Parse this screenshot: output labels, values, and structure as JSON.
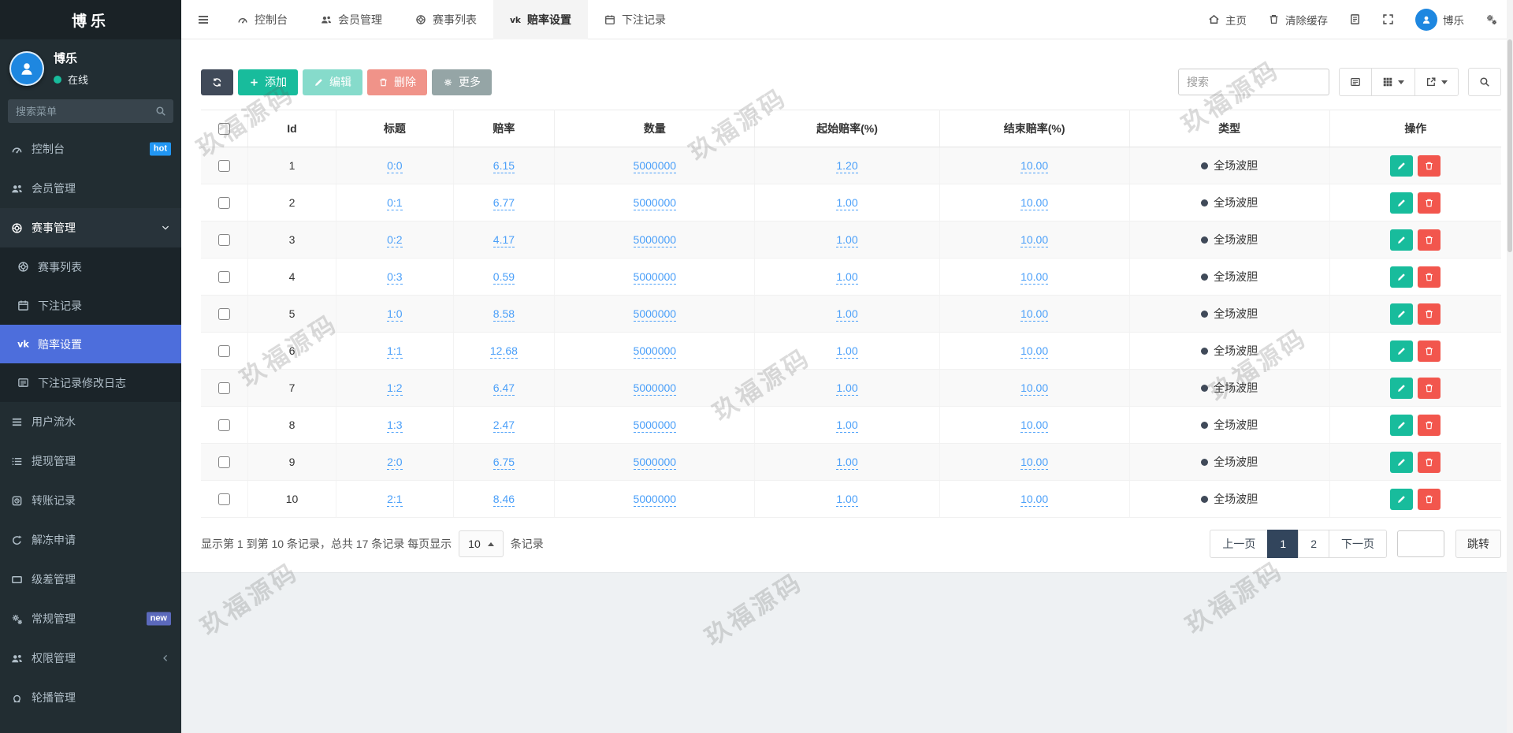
{
  "app": {
    "logo_text": "博乐",
    "watermark_text": "玖福源码"
  },
  "colors": {
    "sidebar_active": "#4d6edc",
    "btn_dark": "#404a59",
    "btn_green": "#18bc9c",
    "btn_red": "#e74c3c",
    "btn_gray": "#95a5a6",
    "op_red": "#f2564d",
    "link_blue": "#4a9ff9",
    "hot_badge": "#2196f3",
    "new_badge": "#5b69bc",
    "avatar_blue": "#1e87e0",
    "online_green": "#18bc9c",
    "page_active": "#32455c",
    "type_dot": "#404a59"
  },
  "topnav": {
    "tabs": [
      {
        "label": "控制台",
        "icon": "gauge",
        "active": false
      },
      {
        "label": "会员管理",
        "icon": "users",
        "active": false
      },
      {
        "label": "赛事列表",
        "icon": "soccer",
        "active": false
      },
      {
        "label": "赔率设置",
        "icon": "vk",
        "active": true
      },
      {
        "label": "下注记录",
        "icon": "calendar",
        "active": false
      }
    ],
    "right_items": [
      {
        "label": "主页",
        "icon": "home",
        "name": "home"
      },
      {
        "label": "清除缓存",
        "icon": "trash",
        "name": "clear-cache"
      },
      {
        "label": "",
        "icon": "file",
        "name": "document"
      },
      {
        "label": "",
        "icon": "expand",
        "name": "fullscreen"
      },
      {
        "label": "博乐",
        "icon": "person",
        "name": "user-menu"
      },
      {
        "label": "",
        "icon": "cogs",
        "name": "settings"
      }
    ]
  },
  "sidebar": {
    "user": {
      "name": "博乐",
      "status": "在线"
    },
    "search_placeholder": "搜索菜单",
    "menu": [
      {
        "label": "控制台",
        "icon": "gauge",
        "badge": "hot"
      },
      {
        "label": "会员管理",
        "icon": "users"
      },
      {
        "label": "赛事管理",
        "icon": "soccer",
        "expanded": true,
        "children": [
          {
            "label": "赛事列表",
            "icon": "soccer"
          },
          {
            "label": "下注记录",
            "icon": "calendar"
          },
          {
            "label": "赔率设置",
            "icon": "vk",
            "active": true
          },
          {
            "label": "下注记录修改日志",
            "icon": "listalt"
          }
        ]
      },
      {
        "label": "用户流水",
        "icon": "bars"
      },
      {
        "label": "提现管理",
        "icon": "tasks"
      },
      {
        "label": "转账记录",
        "icon": "transfer"
      },
      {
        "label": "解冻申请",
        "icon": "redo"
      },
      {
        "label": "级差管理",
        "icon": "rect"
      },
      {
        "label": "常规管理",
        "icon": "cogs",
        "badge": "new"
      },
      {
        "label": "权限管理",
        "icon": "users",
        "collapsed": true
      },
      {
        "label": "轮播管理",
        "icon": "image"
      }
    ]
  },
  "toolbar": {
    "add_label": "添加",
    "edit_label": "编辑",
    "delete_label": "删除",
    "more_label": "更多",
    "search_placeholder": "搜索"
  },
  "table": {
    "columns": [
      "Id",
      "标题",
      "赔率",
      "数量",
      "起始赔率(%)",
      "结束赔率(%)",
      "类型",
      "操作"
    ],
    "rows": [
      {
        "id": "1",
        "title": "0:0",
        "odds": "6.15",
        "quantity": "5000000",
        "start_rate": "1.20",
        "end_rate": "10.00",
        "type": "全场波胆"
      },
      {
        "id": "2",
        "title": "0:1",
        "odds": "6.77",
        "quantity": "5000000",
        "start_rate": "1.00",
        "end_rate": "10.00",
        "type": "全场波胆"
      },
      {
        "id": "3",
        "title": "0:2",
        "odds": "4.17",
        "quantity": "5000000",
        "start_rate": "1.00",
        "end_rate": "10.00",
        "type": "全场波胆"
      },
      {
        "id": "4",
        "title": "0:3",
        "odds": "0.59",
        "quantity": "5000000",
        "start_rate": "1.00",
        "end_rate": "10.00",
        "type": "全场波胆"
      },
      {
        "id": "5",
        "title": "1:0",
        "odds": "8.58",
        "quantity": "5000000",
        "start_rate": "1.00",
        "end_rate": "10.00",
        "type": "全场波胆"
      },
      {
        "id": "6",
        "title": "1:1",
        "odds": "12.68",
        "quantity": "5000000",
        "start_rate": "1.00",
        "end_rate": "10.00",
        "type": "全场波胆"
      },
      {
        "id": "7",
        "title": "1:2",
        "odds": "6.47",
        "quantity": "5000000",
        "start_rate": "1.00",
        "end_rate": "10.00",
        "type": "全场波胆"
      },
      {
        "id": "8",
        "title": "1:3",
        "odds": "2.47",
        "quantity": "5000000",
        "start_rate": "1.00",
        "end_rate": "10.00",
        "type": "全场波胆"
      },
      {
        "id": "9",
        "title": "2:0",
        "odds": "6.75",
        "quantity": "5000000",
        "start_rate": "1.00",
        "end_rate": "10.00",
        "type": "全场波胆"
      },
      {
        "id": "10",
        "title": "2:1",
        "odds": "8.46",
        "quantity": "5000000",
        "start_rate": "1.00",
        "end_rate": "10.00",
        "type": "全场波胆"
      }
    ]
  },
  "pagination": {
    "info_prefix": "显示第 1 到第 10 条记录，总共 17 条记录 每页显示",
    "page_size": "10",
    "info_suffix": "条记录",
    "prev_label": "上一页",
    "pages": [
      "1",
      "2"
    ],
    "active_page": "1",
    "next_label": "下一页",
    "jump_label": "跳转"
  }
}
